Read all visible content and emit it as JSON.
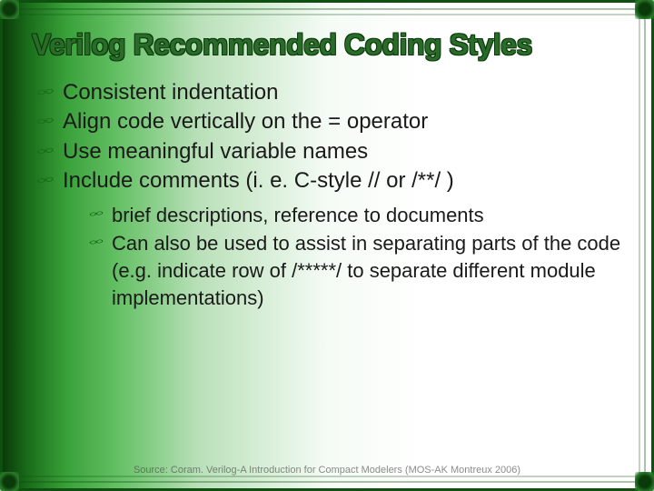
{
  "title": "Verilog Recommended Coding Styles",
  "bullets": [
    {
      "text": "Consistent indentation"
    },
    {
      "text": "Align code vertically on the = operator"
    },
    {
      "text": "Use meaningful variable names"
    },
    {
      "text": "Include comments  (i. e. C-style // or /**/ )"
    }
  ],
  "sub_bullets": [
    {
      "text": "brief descriptions, reference to documents"
    },
    {
      "text": "Can also be used to assist in separating parts of the code (e.g. indicate row of /*****/ to separate different module implementations)"
    }
  ],
  "footer": "Source: Coram. Verilog-A Introduction for Compact Modelers (MOS-AK Montreux 2006)"
}
